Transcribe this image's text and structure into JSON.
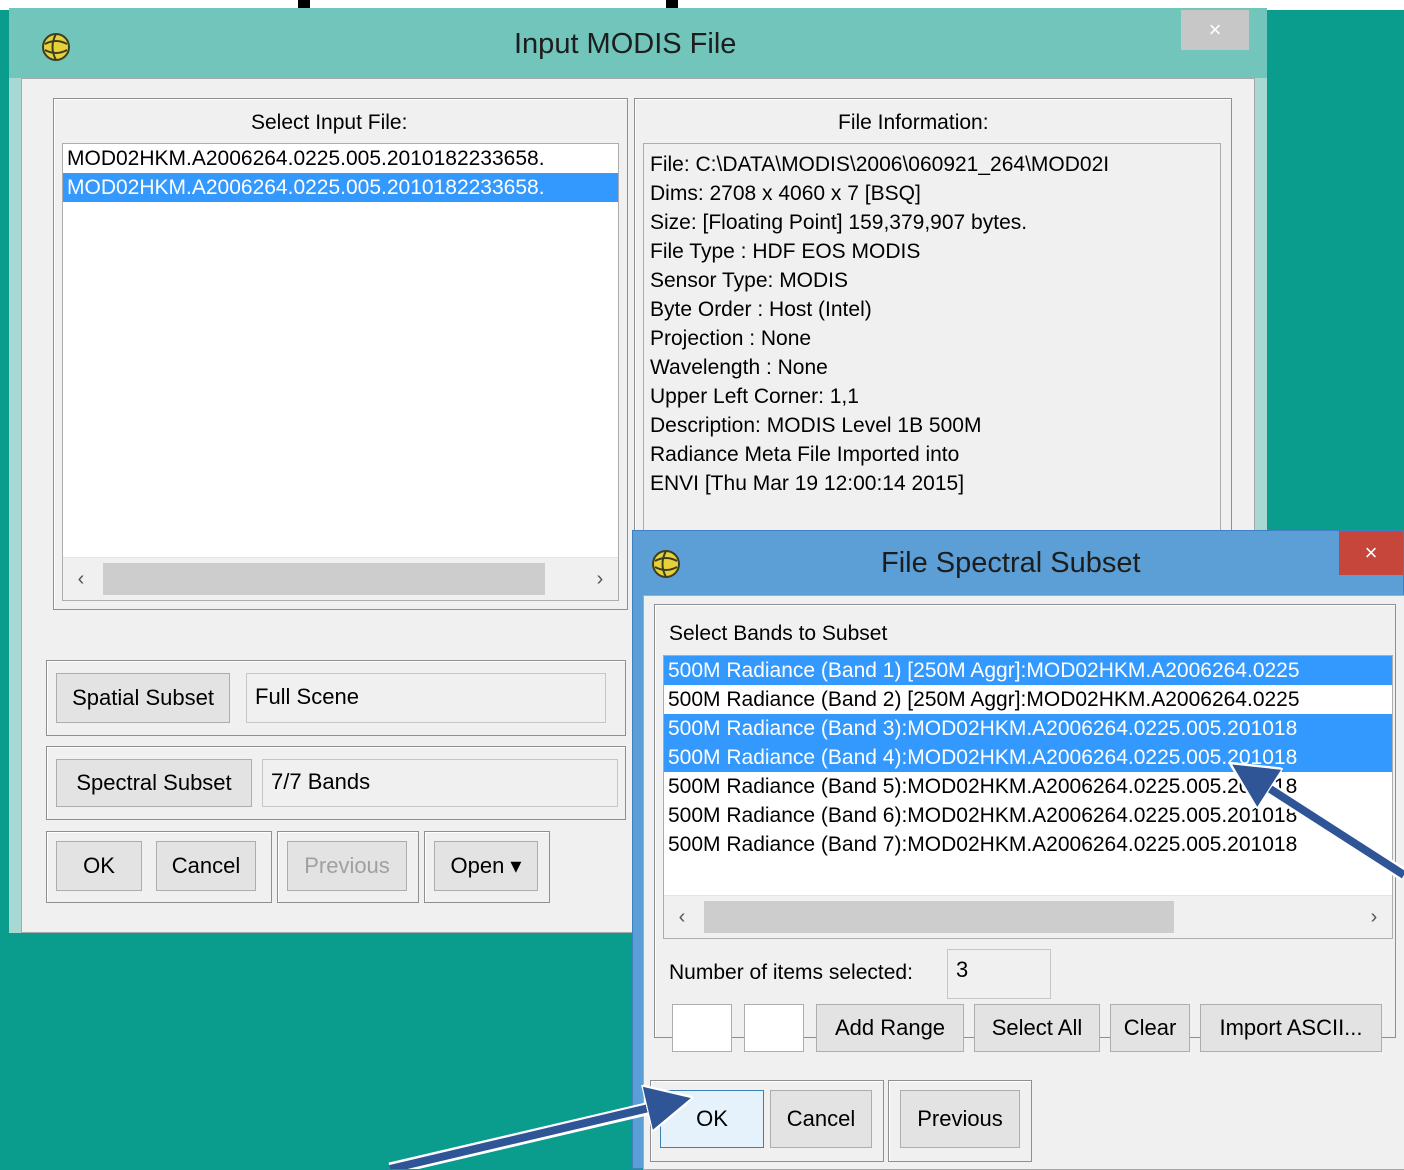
{
  "colors": {
    "desktop": "#0a9c8c",
    "selection": "#3399ff",
    "arrow": "#2f5597"
  },
  "input_dialog": {
    "title": "Input MODIS File",
    "close_glyph": "×",
    "select_label": "Select Input File:",
    "files": [
      "MOD02HKM.A2006264.0225.005.2010182233658.",
      "MOD02HKM.A2006264.0225.005.2010182233658."
    ],
    "info_label": "File Information:",
    "info_lines": [
      "File: C:\\DATA\\MODIS\\2006\\060921_264\\MOD02I",
      "Dims: 2708 x 4060 x 7 [BSQ]",
      "Size: [Floating Point] 159,379,907 bytes.",
      "File Type  : HDF EOS MODIS",
      "Sensor Type: MODIS",
      "Byte Order : Host (Intel)",
      "Projection : None",
      "Wavelength : None",
      "Upper Left Corner: 1,1",
      "Description: MODIS Level 1B 500M",
      "Radiance Meta File Imported into",
      "ENVI [Thu Mar 19 12:00:14 2015]"
    ],
    "spatial_button": "Spatial Subset",
    "spatial_value": "Full Scene",
    "spectral_button": "Spectral Subset",
    "spectral_value": "7/7 Bands",
    "ok": "OK",
    "cancel": "Cancel",
    "previous": "Previous",
    "open": "Open ▾"
  },
  "subset_dialog": {
    "title": "File Spectral Subset",
    "close_glyph": "×",
    "select_label": "Select Bands to Subset",
    "bands": [
      {
        "label": "500M Radiance (Band 1) [250M Aggr]:MOD02HKM.A2006264.0225",
        "selected": true
      },
      {
        "label": "500M Radiance (Band 2) [250M Aggr]:MOD02HKM.A2006264.0225",
        "selected": false
      },
      {
        "label": "500M Radiance (Band 3):MOD02HKM.A2006264.0225.005.201018",
        "selected": true
      },
      {
        "label": "500M Radiance (Band 4):MOD02HKM.A2006264.0225.005.201018",
        "selected": true
      },
      {
        "label": "500M Radiance (Band 5):MOD02HKM.A2006264.0225.005.201018",
        "selected": false
      },
      {
        "label": "500M Radiance (Band 6):MOD02HKM.A2006264.0225.005.201018",
        "selected": false
      },
      {
        "label": "500M Radiance (Band 7):MOD02HKM.A2006264.0225.005.201018",
        "selected": false
      }
    ],
    "count_label": "Number of items selected:",
    "count_value": "3",
    "add_range": "Add Range",
    "select_all": "Select All",
    "clear": "Clear",
    "import_ascii": "Import ASCII...",
    "ok": "OK",
    "cancel": "Cancel",
    "previous": "Previous"
  }
}
